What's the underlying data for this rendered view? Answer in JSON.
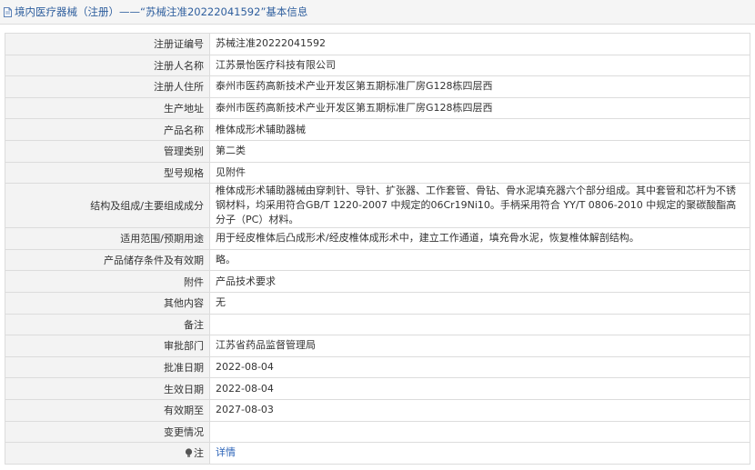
{
  "header": {
    "title": "境内医疗器械（注册）——“苏械注准20222041592”基本信息",
    "icon": "document-icon"
  },
  "rows": [
    {
      "label": "注册证编号",
      "value": "苏械注准20222041592"
    },
    {
      "label": "注册人名称",
      "value": "江苏景怡医疗科技有限公司"
    },
    {
      "label": "注册人住所",
      "value": "泰州市医药高新技术产业开发区第五期标准厂房G128栋四层西"
    },
    {
      "label": "生产地址",
      "value": "泰州市医药高新技术产业开发区第五期标准厂房G128栋四层西"
    },
    {
      "label": "产品名称",
      "value": "椎体成形术辅助器械"
    },
    {
      "label": "管理类别",
      "value": "第二类"
    },
    {
      "label": "型号规格",
      "value": "见附件"
    },
    {
      "label": "结构及组成/主要组成成分",
      "value": "椎体成形术辅助器械由穿刺针、导针、扩张器、工作套管、骨钻、骨水泥填充器六个部分组成。其中套管和芯杆为不锈钢材料，均采用符合GB/T 1220-2007 中规定的06Cr19Ni10。手柄采用符合 YY/T 0806-2010 中规定的聚碳酸酯高分子（PC）材料。"
    },
    {
      "label": "适用范围/预期用途",
      "value": "用于经皮椎体后凸成形术/经皮椎体成形术中，建立工作通道，填充骨水泥，恢复椎体解剖结构。"
    },
    {
      "label": "产品储存条件及有效期",
      "value": "略。"
    },
    {
      "label": "附件",
      "value": "产品技术要求"
    },
    {
      "label": "其他内容",
      "value": "无"
    },
    {
      "label": "备注",
      "value": ""
    },
    {
      "label": "审批部门",
      "value": "江苏省药品监督管理局"
    },
    {
      "label": "批准日期",
      "value": "2022-08-04"
    },
    {
      "label": "生效日期",
      "value": "2022-08-04"
    },
    {
      "label": "有效期至",
      "value": "2027-08-03"
    },
    {
      "label": "变更情况",
      "value": ""
    }
  ],
  "footer_row": {
    "label_icon": "lightbulb-icon",
    "label": "注",
    "link_text": "详情"
  },
  "colors": {
    "title": "#2f5f9e",
    "link": "#2c64b8",
    "label_bg": "#f3f3f3",
    "border": "#dcdcdc"
  }
}
